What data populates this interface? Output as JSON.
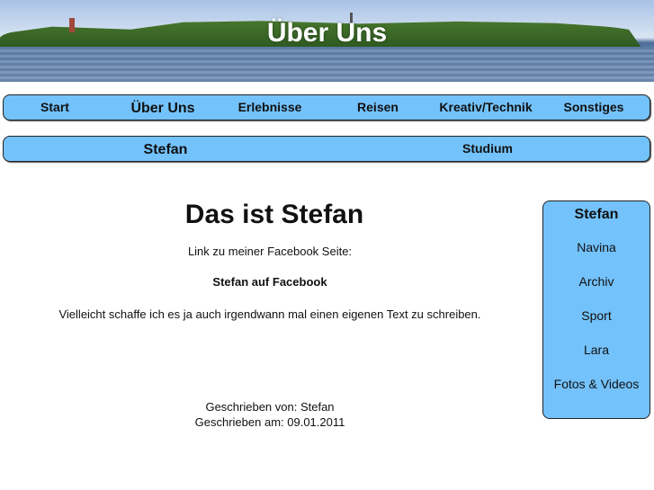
{
  "banner": {
    "title": "Über Uns"
  },
  "nav": {
    "items": [
      "Start",
      "Über Uns",
      "Erlebnisse",
      "Reisen",
      "Kreativ/Technik",
      "Sonstiges"
    ]
  },
  "subnav": {
    "items": [
      "Stefan",
      "Studium"
    ]
  },
  "main": {
    "title": "Das ist Stefan",
    "fb_intro": "Link zu meiner Facebook Seite:",
    "fb_link": "Stefan auf Facebook",
    "text": "Vielleicht schaffe ich es ja auch irgendwann mal einen eigenen Text zu schreiben.",
    "author": "Geschrieben von: Stefan",
    "date": "Geschrieben am: 09.01.2011"
  },
  "sidebar": {
    "title": "Stefan",
    "items": [
      "Navina",
      "Archiv",
      "Sport",
      "Lara",
      "Fotos & Videos"
    ]
  }
}
